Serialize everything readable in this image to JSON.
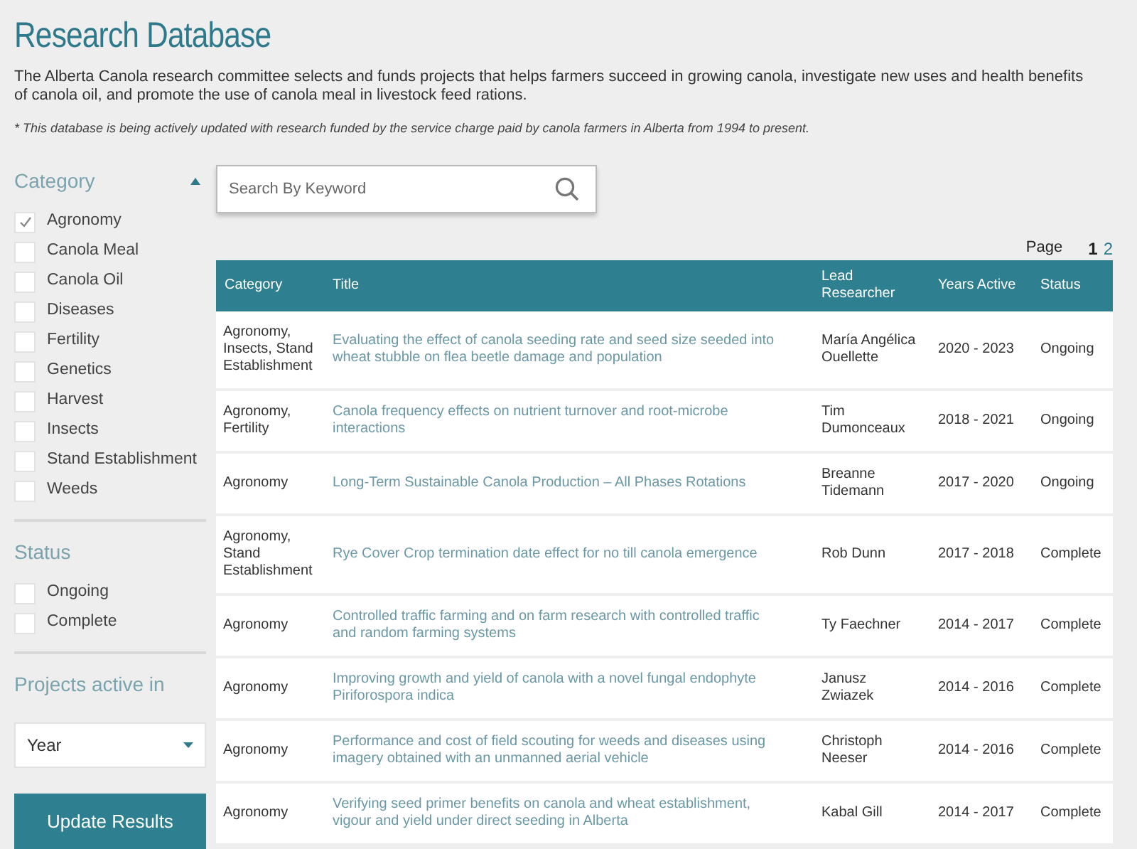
{
  "title": "Research Database",
  "intro": "The Alberta Canola research committee selects and funds projects that helps farmers succeed in growing canola, investigate new uses and health benefits of canola oil, and promote the use of canola meal in livestock feed rations.",
  "note": "* This database is being actively updated with research funded by the service charge paid by canola farmers in Alberta from 1994 to present.",
  "filters": {
    "category": {
      "label": "Category",
      "expanded": true,
      "items": [
        {
          "label": "Agronomy",
          "checked": true
        },
        {
          "label": "Canola Meal",
          "checked": false
        },
        {
          "label": "Canola Oil",
          "checked": false
        },
        {
          "label": "Diseases",
          "checked": false
        },
        {
          "label": "Fertility",
          "checked": false
        },
        {
          "label": "Genetics",
          "checked": false
        },
        {
          "label": "Harvest",
          "checked": false
        },
        {
          "label": "Insects",
          "checked": false
        },
        {
          "label": "Stand Establishment",
          "checked": false
        },
        {
          "label": "Weeds",
          "checked": false
        }
      ]
    },
    "status": {
      "label": "Status",
      "items": [
        {
          "label": "Ongoing",
          "checked": false
        },
        {
          "label": "Complete",
          "checked": false
        }
      ]
    },
    "projects_active": {
      "label": "Projects active in",
      "select": "Year"
    },
    "button": "Update Results"
  },
  "search": {
    "placeholder": "Search By Keyword"
  },
  "pagination": {
    "label": "Page",
    "pages": [
      {
        "label": "1",
        "selected": true
      },
      {
        "label": "2",
        "selected": false
      }
    ]
  },
  "table": {
    "columns": [
      "Category",
      "Title",
      "Lead Researcher",
      "Years Active",
      "Status"
    ],
    "rows": [
      {
        "category": "Agronomy, Insects, Stand Establishment",
        "title": "Evaluating the effect of canola seeding rate and seed size seeded into wheat stubble on flea beetle damage and population",
        "lead": "María Angélica Ouellette",
        "years": "2020 - 2023",
        "status": "Ongoing"
      },
      {
        "category": "Agronomy, Fertility",
        "title": "Canola frequency effects on nutrient turnover and root-microbe interactions",
        "lead": "Tim Dumonceaux",
        "years": "2018 - 2021",
        "status": "Ongoing"
      },
      {
        "category": "Agronomy",
        "title": "Long-Term Sustainable Canola Production – All Phases Rotations",
        "lead": "Breanne Tidemann",
        "years": "2017 - 2020",
        "status": "Ongoing"
      },
      {
        "category": "Agronomy, Stand Establishment",
        "title": "Rye Cover Crop termination date effect for no till canola emergence",
        "lead": "Rob Dunn",
        "years": "2017 - 2018",
        "status": "Complete"
      },
      {
        "category": "Agronomy",
        "title": "Controlled traffic farming and on farm research with controlled traffic and random farming systems",
        "lead": "Ty Faechner",
        "years": "2014 - 2017",
        "status": "Complete"
      },
      {
        "category": "Agronomy",
        "title": "Improving growth and yield of canola with a novel fungal endophyte Piriforospora indica",
        "lead": "Janusz Zwiazek",
        "years": "2014 - 2016",
        "status": "Complete"
      },
      {
        "category": "Agronomy",
        "title": "Performance and cost of field scouting for weeds and diseases using imagery obtained with an unmanned aerial vehicle",
        "lead": "Christoph Neeser",
        "years": "2014 - 2016",
        "status": "Complete"
      },
      {
        "category": "Agronomy",
        "title": "Verifying seed primer benefits on canola and wheat establishment, vigour and yield under direct seeding in Alberta",
        "lead": "Kabal Gill",
        "years": "2014 - 2017",
        "status": "Complete"
      }
    ]
  }
}
